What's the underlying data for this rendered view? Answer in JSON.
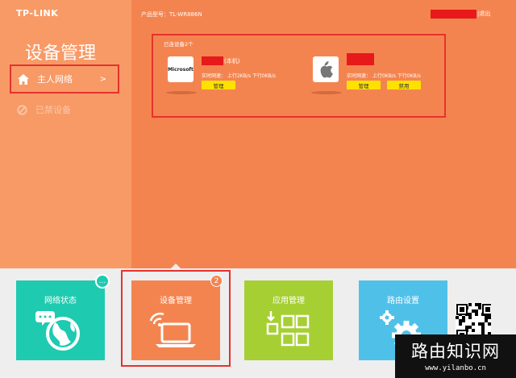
{
  "header": {
    "brand": "TP-LINK",
    "model_text": "产品型号：TL-WR886N",
    "logout_label": "|退出"
  },
  "sidebar": {
    "title": "设备管理",
    "items": [
      {
        "label": "主人网络",
        "chevron": ">",
        "icon": "home-icon"
      },
      {
        "label": "已禁设备",
        "icon": "block-icon"
      }
    ]
  },
  "devices_panel": {
    "count_text": "已连设备2个",
    "devices": [
      {
        "logo_text": "Microsoft",
        "tag": "(本机)",
        "speed_label": "实时网速：",
        "upload": "上行2KB/s",
        "download": "下行0KB/s",
        "buttons": [
          "管理"
        ]
      },
      {
        "logo_icon": "apple-icon",
        "speed_label": "实时网速：",
        "upload": "上行0KB/s",
        "download": "下行0KB/s",
        "buttons": [
          "管理",
          "禁用"
        ]
      }
    ]
  },
  "nav_tiles": [
    {
      "label": "网络状态",
      "icon": "globe-icon",
      "color": "#1ecbb0",
      "more": "..."
    },
    {
      "label": "设备管理",
      "icon": "laptop-wifi-icon",
      "color": "#f4844f",
      "badge": "2"
    },
    {
      "label": "应用管理",
      "icon": "apps-grid-icon",
      "color": "#a6cf33"
    },
    {
      "label": "路由设置",
      "icon": "gear-icon",
      "color": "#4fc1e9"
    }
  ],
  "watermark": {
    "title": "路由知识网",
    "url": "www.yilanbo.cn"
  },
  "colors": {
    "main_bg": "#f4844f",
    "sidebar_bg": "#f89a66",
    "highlight": "#e5322e",
    "button": "#ffe100"
  }
}
